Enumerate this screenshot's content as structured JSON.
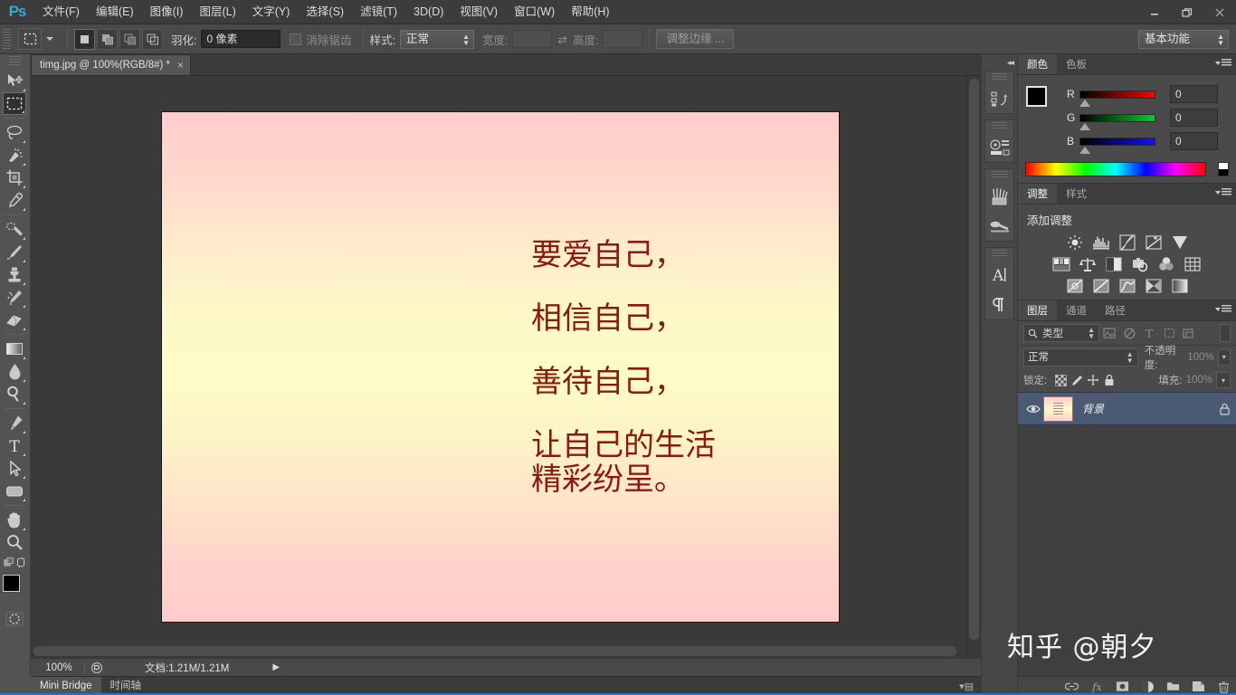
{
  "app": {
    "logo": "Ps",
    "name": "Adobe Photoshop"
  },
  "menubar": {
    "items": [
      {
        "label": "文件(F)",
        "name": "menu-file"
      },
      {
        "label": "编辑(E)",
        "name": "menu-edit"
      },
      {
        "label": "图像(I)",
        "name": "menu-image"
      },
      {
        "label": "图层(L)",
        "name": "menu-layer"
      },
      {
        "label": "文字(Y)",
        "name": "menu-type"
      },
      {
        "label": "选择(S)",
        "name": "menu-select"
      },
      {
        "label": "滤镜(T)",
        "name": "menu-filter"
      },
      {
        "label": "3D(D)",
        "name": "menu-3d"
      },
      {
        "label": "视图(V)",
        "name": "menu-view"
      },
      {
        "label": "窗口(W)",
        "name": "menu-window"
      },
      {
        "label": "帮助(H)",
        "name": "menu-help"
      }
    ]
  },
  "window_controls": {
    "minimize": "—",
    "restore": "❐",
    "close": "✕"
  },
  "options_bar": {
    "feather_label": "羽化:",
    "feather_value": "0 像素",
    "antialias_label": "消除锯齿",
    "style_label": "样式:",
    "style_value": "正常",
    "width_label": "宽度:",
    "width_value": "",
    "swap_icon": "⇄",
    "height_label": "高度:",
    "height_value": "",
    "refine_edge": "调整边缘 ...",
    "workspace": "基本功能"
  },
  "toolbar": {
    "tools": [
      {
        "name": "move-tool",
        "label": "移动工具"
      },
      {
        "name": "marquee-tool",
        "label": "矩形选框工具",
        "selected": true
      },
      {
        "name": "lasso-tool",
        "label": "套索工具"
      },
      {
        "name": "quick-selection-tool",
        "label": "快速选择工具"
      },
      {
        "name": "crop-tool",
        "label": "裁剪工具"
      },
      {
        "name": "eyedropper-tool",
        "label": "吸管工具"
      },
      {
        "name": "healing-brush-tool",
        "label": "污点修复画笔工具"
      },
      {
        "name": "brush-tool",
        "label": "画笔工具"
      },
      {
        "name": "clone-stamp-tool",
        "label": "仿制图章工具"
      },
      {
        "name": "history-brush-tool",
        "label": "历史记录画笔工具"
      },
      {
        "name": "eraser-tool",
        "label": "橡皮擦工具"
      },
      {
        "name": "gradient-tool",
        "label": "渐变工具"
      },
      {
        "name": "blur-tool",
        "label": "模糊工具"
      },
      {
        "name": "dodge-tool",
        "label": "减淡工具"
      },
      {
        "name": "pen-tool",
        "label": "钢笔工具"
      },
      {
        "name": "type-tool",
        "label": "横排文字工具"
      },
      {
        "name": "path-selection-tool",
        "label": "路径选择工具"
      },
      {
        "name": "shape-tool",
        "label": "圆角矩形工具"
      },
      {
        "name": "hand-tool",
        "label": "抓手工具"
      },
      {
        "name": "zoom-tool",
        "label": "缩放工具"
      }
    ],
    "foreground_color": "#000000",
    "background_color": "#ffffff",
    "quick_mask": "以快速蒙版模式编辑"
  },
  "document": {
    "tab_title": "timg.jpg @ 100%(RGB/8#) *",
    "close_glyph": "×",
    "canvas_text": {
      "lines": [
        "要爱自己，",
        "相信自己，",
        "善待自己，",
        "让自己的生活",
        "精彩纷呈。"
      ],
      "color": "#8a1a0f"
    },
    "gradient_top": "#ffcccc",
    "gradient_mid": "#fdfcc6",
    "gradient_bottom": "#ffcccc"
  },
  "status_bar": {
    "zoom": "100%",
    "doc_info": "文档:1.21M/1.21M",
    "expand_glyph": "▶"
  },
  "bottom_panels": {
    "tabs": [
      {
        "label": "Mini Bridge",
        "name": "bottom-tab-mini-bridge",
        "active": true
      },
      {
        "label": "时间轴",
        "name": "bottom-tab-timeline",
        "active": false
      }
    ]
  },
  "mini_dock": {
    "collapse_glyph": "◂◂",
    "icons": [
      {
        "name": "history-panel-icon"
      },
      {
        "name": "actions-panel-icon"
      },
      {
        "name": "brush-panel-icon"
      },
      {
        "name": "brush-presets-panel-icon"
      },
      {
        "name": "character-panel-icon"
      },
      {
        "name": "paragraph-panel-icon"
      }
    ]
  },
  "color_panel": {
    "tabs": [
      {
        "label": "颜色",
        "active": true
      },
      {
        "label": "色板",
        "active": false
      }
    ],
    "channels": [
      {
        "label": "R",
        "value": "0",
        "from": "#000000",
        "to": "#ff0000"
      },
      {
        "label": "G",
        "value": "0",
        "from": "#000000",
        "to": "#00ff00"
      },
      {
        "label": "B",
        "value": "0",
        "from": "#000000",
        "to": "#0000ff"
      }
    ],
    "foreground": "#000000",
    "background": "#ffffff"
  },
  "adjustments_panel": {
    "tabs": [
      {
        "label": "调整",
        "active": true
      },
      {
        "label": "样式",
        "active": false
      }
    ],
    "title": "添加调整",
    "rows": [
      [
        {
          "name": "brightness-contrast-icon"
        },
        {
          "name": "levels-icon"
        },
        {
          "name": "curves-icon"
        },
        {
          "name": "exposure-icon"
        },
        {
          "name": "vibrance-icon"
        }
      ],
      [
        {
          "name": "hue-saturation-icon"
        },
        {
          "name": "color-balance-icon"
        },
        {
          "name": "black-white-icon"
        },
        {
          "name": "photo-filter-icon"
        },
        {
          "name": "channel-mixer-icon"
        },
        {
          "name": "color-lookup-icon"
        }
      ],
      [
        {
          "name": "invert-icon"
        },
        {
          "name": "posterize-icon"
        },
        {
          "name": "threshold-icon"
        },
        {
          "name": "selective-color-icon"
        },
        {
          "name": "gradient-map-icon"
        }
      ]
    ]
  },
  "layers_panel": {
    "tabs": [
      {
        "label": "图层",
        "active": true
      },
      {
        "label": "通道",
        "active": false
      },
      {
        "label": "路径",
        "active": false
      }
    ],
    "filter_label": "类型",
    "filter_icons": [
      {
        "name": "filter-pixel-icon"
      },
      {
        "name": "filter-adjustment-icon"
      },
      {
        "name": "filter-type-icon"
      },
      {
        "name": "filter-shape-icon"
      },
      {
        "name": "filter-smart-object-icon"
      }
    ],
    "blend_mode": "正常",
    "opacity_label": "不透明度:",
    "opacity_value": "100%",
    "lock_label": "锁定:",
    "lock_icons": [
      {
        "name": "lock-transparency-icon"
      },
      {
        "name": "lock-image-icon"
      },
      {
        "name": "lock-position-icon"
      },
      {
        "name": "lock-all-icon"
      }
    ],
    "fill_label": "填充:",
    "fill_value": "100%",
    "layers": [
      {
        "name": "背景",
        "visible": true,
        "locked": true,
        "selected": true
      }
    ],
    "footer_buttons": [
      {
        "name": "link-layers-button",
        "label": "链接图层"
      },
      {
        "name": "layer-style-button",
        "label": "添加图层样式"
      },
      {
        "name": "layer-mask-button",
        "label": "添加图层蒙版"
      },
      {
        "name": "new-fill-adjustment-button",
        "label": "创建新的填充或调整图层"
      },
      {
        "name": "new-group-button",
        "label": "创建新组"
      },
      {
        "name": "new-layer-button",
        "label": "创建新图层"
      },
      {
        "name": "delete-layer-button",
        "label": "删除图层"
      }
    ]
  },
  "watermark": {
    "text": "知乎 @朝夕"
  }
}
